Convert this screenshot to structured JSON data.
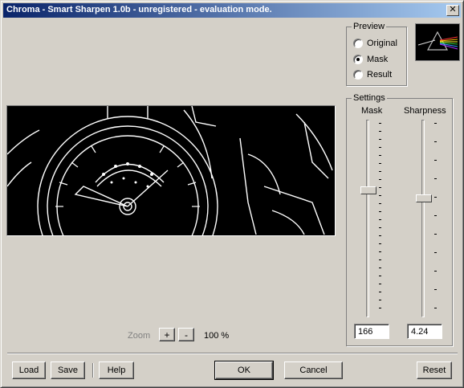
{
  "window": {
    "title": "Chroma - Smart Sharpen 1.0b - unregistered - evaluation mode.",
    "close_glyph": "✕"
  },
  "preview": {
    "legend": "Preview",
    "options": [
      "Original",
      "Mask",
      "Result"
    ],
    "selected": "Mask"
  },
  "settings": {
    "legend": "Settings",
    "mask_label": "Mask",
    "sharpness_label": "Sharpness",
    "mask_value": "166",
    "sharpness_value": "4.24"
  },
  "zoom": {
    "label": "Zoom",
    "plus": "+",
    "minus": "-",
    "value": "100 %"
  },
  "buttons": {
    "load": "Load",
    "save": "Save",
    "help": "Help",
    "ok": "OK",
    "cancel": "Cancel",
    "reset": "Reset"
  },
  "icons": {
    "logo": "prism-logo-icon",
    "close": "close-icon"
  }
}
